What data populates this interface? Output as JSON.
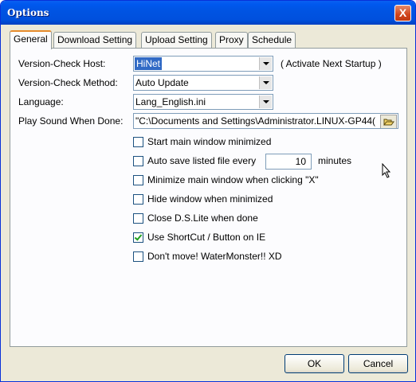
{
  "window": {
    "title": "Options",
    "close_label": "X"
  },
  "tabs": [
    "General",
    "Download Setting",
    "Upload Setting",
    "Proxy",
    "Schedule"
  ],
  "fields": {
    "host": {
      "label": "Version-Check Host:",
      "value": "HiNet",
      "note": "( Activate Next Startup )"
    },
    "method": {
      "label": "Version-Check Method:",
      "value": "Auto Update"
    },
    "language": {
      "label": "Language:",
      "value": "Lang_English.ini"
    },
    "sound": {
      "label": "Play Sound When Done:",
      "value": "\"C:\\Documents and Settings\\Administrator.LINUX-GP44("
    }
  },
  "checks": [
    {
      "label": "Start main window minimized",
      "checked": false
    },
    {
      "label": "Auto save listed file every",
      "checked": false,
      "value": "10",
      "suffix": "minutes"
    },
    {
      "label": "Minimize main window when clicking \"X\"",
      "checked": false
    },
    {
      "label": "Hide window when minimized",
      "checked": false
    },
    {
      "label": "Close D.S.Lite when done",
      "checked": false
    },
    {
      "label": "Use ShortCut / Button on IE",
      "checked": true
    },
    {
      "label": "Don't move! WaterMonster!! XD",
      "checked": false
    }
  ],
  "buttons": {
    "ok": "OK",
    "cancel": "Cancel"
  }
}
